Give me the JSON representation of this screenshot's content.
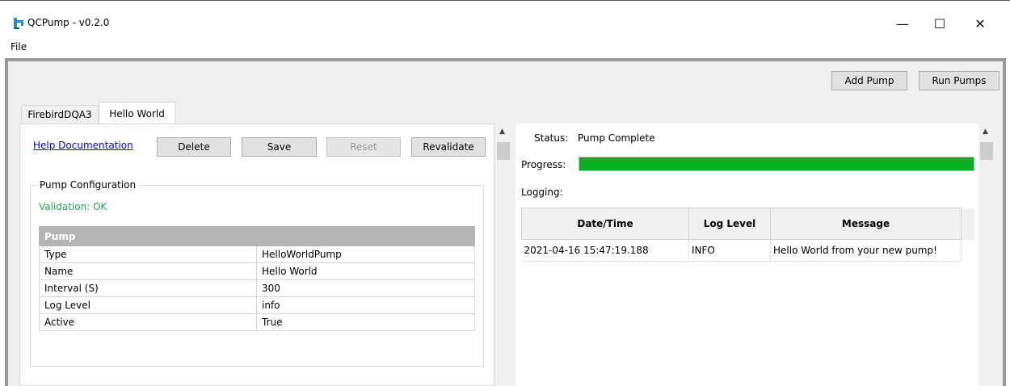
{
  "window": {
    "title": "QCPump - v0.2.0",
    "minimize_glyph": "—",
    "maximize_glyph": "☐",
    "close_glyph": "✕"
  },
  "menu": {
    "file": "File"
  },
  "toolbar": {
    "add_pump": "Add Pump",
    "run_pumps": "Run Pumps"
  },
  "tabs": [
    {
      "label": "FirebirdDQA3",
      "active": false
    },
    {
      "label": "Hello World",
      "active": true
    }
  ],
  "pump_panel": {
    "help_link": "Help Documentation",
    "delete": "Delete",
    "save": "Save",
    "reset": "Reset",
    "revalidate": "Revalidate",
    "group_title": "Pump Configuration",
    "validation": "Validation: OK",
    "validation_color": "#22aa55",
    "config_header": "Pump",
    "config_rows": [
      {
        "key": "Type",
        "value": "HelloWorldPump"
      },
      {
        "key": "Name",
        "value": "Hello World"
      },
      {
        "key": "Interval (S)",
        "value": "300"
      },
      {
        "key": "Log Level",
        "value": "info"
      },
      {
        "key": "Active",
        "value": "True"
      }
    ]
  },
  "status_panel": {
    "status_label": "Status:",
    "status_value": "Pump Complete",
    "progress_label": "Progress:",
    "progress_fraction": 1.0,
    "progress_color": "#06b025",
    "logging_label": "Logging:",
    "log_columns": [
      "Date/Time",
      "Log Level",
      "Message"
    ],
    "log_rows": [
      {
        "datetime": "2021-04-16 15:47:19.188",
        "level": "INFO",
        "message": "Hello World from your new pump!"
      }
    ]
  }
}
